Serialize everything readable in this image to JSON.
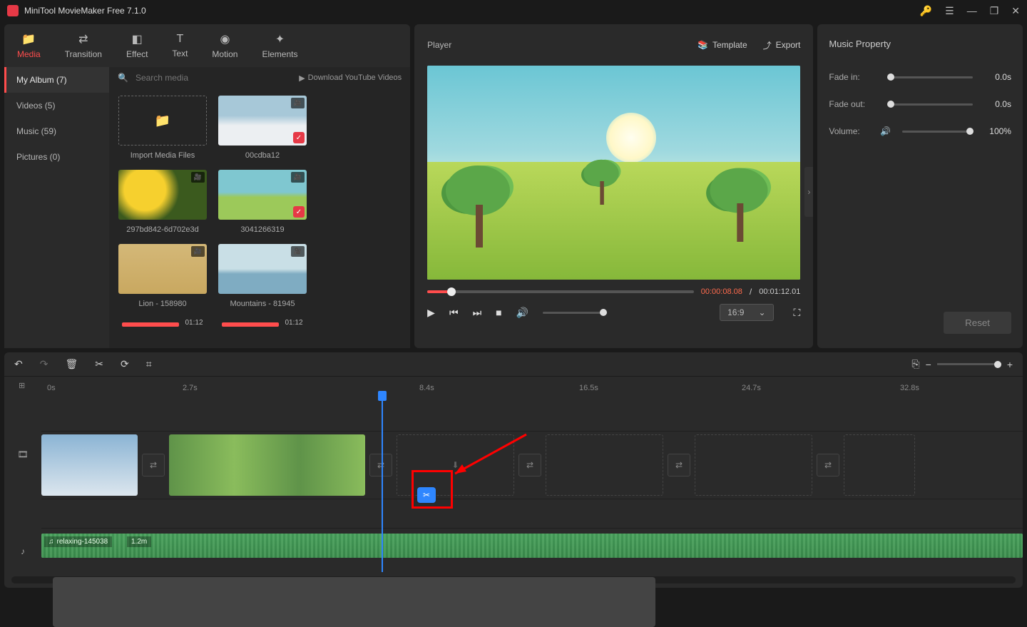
{
  "titlebar": {
    "title": "MiniTool MovieMaker Free 7.1.0"
  },
  "tabs": [
    {
      "label": "Media",
      "active": true
    },
    {
      "label": "Transition"
    },
    {
      "label": "Effect"
    },
    {
      "label": "Text"
    },
    {
      "label": "Motion"
    },
    {
      "label": "Elements"
    }
  ],
  "album": {
    "items": [
      {
        "label": "My Album (7)",
        "active": true
      },
      {
        "label": "Videos (5)"
      },
      {
        "label": "Music (59)"
      },
      {
        "label": "Pictures (0)"
      }
    ]
  },
  "search": {
    "placeholder": "Search media",
    "download": "Download YouTube Videos"
  },
  "media": [
    {
      "label": "Import Media Files",
      "import": true
    },
    {
      "label": "00cdba12",
      "checked": true
    },
    {
      "label": "297bd842-6d702e3d"
    },
    {
      "label": "3041266319",
      "checked": true
    },
    {
      "label": "Lion - 158980"
    },
    {
      "label": "Mountains - 81945"
    }
  ],
  "extra_duration": "01:12",
  "player": {
    "title": "Player",
    "template": "Template",
    "export": "Export",
    "current": "00:00:08.08",
    "total": "00:01:12.01",
    "ratio": "16:9"
  },
  "props": {
    "title": "Music Property",
    "fadein_label": "Fade in:",
    "fadein_val": "0.0s",
    "fadeout_label": "Fade out:",
    "fadeout_val": "0.0s",
    "volume_label": "Volume:",
    "volume_val": "100%",
    "reset": "Reset"
  },
  "ruler": {
    "t0": "0s",
    "t1": "2.7s",
    "t2": "8.4s",
    "t3": "16.5s",
    "t4": "24.7s",
    "t5": "32.8s"
  },
  "audio": {
    "name": "relaxing-145038",
    "duration": "1.2m"
  }
}
